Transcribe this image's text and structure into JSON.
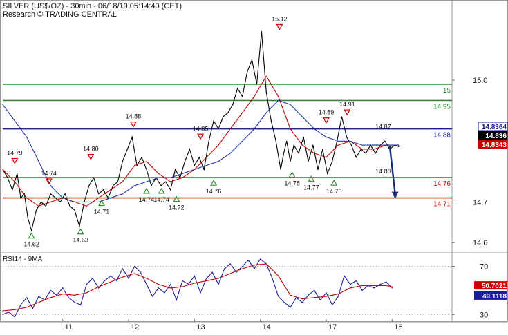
{
  "header": {
    "title": "SILVER (US$/OZ) - 30min - 06/18/19 05:14:40 (CET)",
    "subtitle": "Research © TRADING CENTRAL"
  },
  "colors": {
    "price": "#000000",
    "ma_fast": "#c00000",
    "ma_slow": "#2233aa",
    "resistance": "#2e8b2e",
    "pivot": "#1a1a9a",
    "support": "#cc0000",
    "marker_up": "#2e8b2e",
    "marker_down": "#cc0000",
    "forecast_arrow": "#1a2a7a",
    "last_price_tag": "#000000"
  },
  "chart_data": [
    {
      "type": "line",
      "name": "price",
      "yscale": "linear",
      "ylim": [
        14.58,
        15.16
      ],
      "x_ticks": [
        "11",
        "12",
        "13",
        "14",
        "17",
        "18"
      ],
      "x_tick_pos": [
        1.3,
        2.4,
        3.5,
        4.6,
        5.7,
        6.8
      ],
      "xlim": [
        0.3,
        7.8
      ],
      "y_ticks": [
        14.6,
        14.7,
        15.0
      ],
      "grid": false,
      "series": [
        {
          "role": "price",
          "x": [
            0.3,
            0.38,
            0.46,
            0.54,
            0.6,
            0.66,
            0.72,
            0.78,
            0.86,
            0.94,
            1.02,
            1.1,
            1.18,
            1.26,
            1.34,
            1.42,
            1.5,
            1.58,
            1.66,
            1.74,
            1.82,
            1.9,
            1.98,
            2.06,
            2.14,
            2.22,
            2.3,
            2.38,
            2.46,
            2.54,
            2.62,
            2.7,
            2.78,
            2.86,
            2.94,
            3.02,
            3.1,
            3.18,
            3.26,
            3.34,
            3.42,
            3.5,
            3.58,
            3.66,
            3.74,
            3.82,
            3.9,
            3.98,
            4.06,
            4.14,
            4.22,
            4.3,
            4.38,
            4.46,
            4.54,
            4.62,
            4.7,
            4.78,
            4.86,
            4.94,
            4.99,
            5.04,
            5.1,
            5.16,
            5.24,
            5.32,
            5.4,
            5.48,
            5.56,
            5.64,
            5.72,
            5.8,
            5.88,
            5.96,
            6.04,
            6.12,
            6.2,
            6.28,
            6.36,
            6.44,
            6.52,
            6.6,
            6.68,
            6.76,
            6.84,
            6.92
          ],
          "values": [
            14.78,
            14.76,
            14.73,
            14.77,
            14.71,
            14.72,
            14.66,
            14.63,
            14.68,
            14.7,
            14.69,
            14.72,
            14.71,
            14.7,
            14.72,
            14.69,
            14.68,
            14.64,
            14.7,
            14.74,
            14.76,
            14.72,
            14.73,
            14.71,
            14.74,
            14.75,
            14.8,
            14.83,
            14.86,
            14.79,
            14.81,
            14.78,
            14.74,
            14.76,
            14.74,
            14.75,
            14.73,
            14.78,
            14.76,
            14.8,
            14.83,
            14.79,
            14.81,
            14.78,
            14.85,
            14.9,
            14.88,
            14.91,
            14.92,
            14.94,
            14.98,
            14.96,
            15.02,
            15.05,
            14.99,
            15.12,
            14.97,
            14.9,
            14.85,
            14.78,
            14.82,
            14.85,
            14.8,
            14.84,
            14.82,
            14.86,
            14.8,
            14.84,
            14.78,
            14.83,
            14.77,
            14.8,
            14.85,
            14.91,
            14.86,
            14.84,
            14.81,
            14.83,
            14.82,
            14.84,
            14.82,
            14.84,
            14.85,
            14.83,
            14.84,
            14.836
          ]
        },
        {
          "role": "ma_fast",
          "x": [
            0.3,
            0.5,
            0.7,
            0.9,
            1.1,
            1.3,
            1.5,
            1.7,
            1.9,
            2.1,
            2.3,
            2.5,
            2.7,
            2.9,
            3.1,
            3.3,
            3.5,
            3.7,
            3.9,
            4.1,
            4.3,
            4.5,
            4.7,
            4.9,
            5.1,
            5.3,
            5.5,
            5.7,
            5.9,
            6.1,
            6.3,
            6.5,
            6.7,
            6.92
          ],
          "values": [
            14.78,
            14.75,
            14.71,
            14.69,
            14.7,
            14.71,
            14.7,
            14.69,
            14.71,
            14.73,
            14.75,
            14.79,
            14.8,
            14.77,
            14.75,
            14.76,
            14.78,
            14.81,
            14.84,
            14.88,
            14.92,
            14.96,
            15.01,
            14.96,
            14.88,
            14.84,
            14.82,
            14.81,
            14.84,
            14.85,
            14.83,
            14.83,
            14.84,
            14.84
          ]
        },
        {
          "role": "ma_slow",
          "x": [
            0.3,
            0.5,
            0.7,
            0.9,
            1.1,
            1.3,
            1.5,
            1.7,
            1.9,
            2.1,
            2.3,
            2.5,
            2.7,
            2.9,
            3.1,
            3.3,
            3.5,
            3.7,
            3.9,
            4.1,
            4.3,
            4.5,
            4.7,
            4.9,
            5.1,
            5.3,
            5.5,
            5.7,
            5.9,
            6.1,
            6.3,
            6.5,
            6.7,
            6.92
          ],
          "values": [
            14.94,
            14.9,
            14.86,
            14.8,
            14.74,
            14.71,
            14.7,
            14.7,
            14.7,
            14.71,
            14.72,
            14.74,
            14.75,
            14.76,
            14.76,
            14.77,
            14.78,
            14.79,
            14.8,
            14.82,
            14.85,
            14.88,
            14.92,
            14.95,
            14.94,
            14.91,
            14.88,
            14.86,
            14.85,
            14.85,
            14.84,
            14.84,
            14.84,
            14.84
          ]
        }
      ],
      "levels": [
        {
          "value": 14.99,
          "label": "15",
          "role": "resistance"
        },
        {
          "value": 14.95,
          "label": "14.95",
          "role": "resistance"
        },
        {
          "value": 14.88,
          "label": "14.88",
          "role": "pivot"
        },
        {
          "value": 14.76,
          "label": "14.76",
          "role": "support"
        },
        {
          "value": 14.71,
          "label": "14.71",
          "role": "support"
        }
      ],
      "price_tags": [
        {
          "value": 14.8364,
          "label": "14.8364",
          "role": "pivot"
        },
        {
          "value": 14.836,
          "label": "14.836",
          "role": "last_price_tag"
        },
        {
          "value": 14.8343,
          "label": "14.8343",
          "role": "support"
        }
      ],
      "annotations": [
        {
          "x": 0.78,
          "value": 14.63,
          "label": "14.62",
          "dir": "up"
        },
        {
          "x": 0.5,
          "value": 14.79,
          "label": "14.79",
          "dir": "down"
        },
        {
          "x": 1.07,
          "value": 14.74,
          "label": "14.74",
          "dir": "down"
        },
        {
          "x": 1.6,
          "value": 14.64,
          "label": "14.63",
          "dir": "up"
        },
        {
          "x": 1.77,
          "value": 14.8,
          "label": "14.80",
          "dir": "down"
        },
        {
          "x": 1.95,
          "value": 14.71,
          "label": "14.71",
          "dir": "up"
        },
        {
          "x": 2.48,
          "value": 14.88,
          "label": "14.88",
          "dir": "down"
        },
        {
          "x": 2.7,
          "value": 14.74,
          "label": "14.74",
          "dir": "up"
        },
        {
          "x": 2.95,
          "value": 14.74,
          "label": "14.74",
          "dir": "up"
        },
        {
          "x": 3.2,
          "value": 14.72,
          "label": "14.72",
          "dir": "up"
        },
        {
          "x": 3.6,
          "value": 14.85,
          "label": "14.85",
          "dir": "down"
        },
        {
          "x": 3.82,
          "value": 14.76,
          "label": "14.76",
          "dir": "up"
        },
        {
          "x": 4.92,
          "value": 15.12,
          "label": "15.12",
          "dir": "down"
        },
        {
          "x": 5.13,
          "value": 14.78,
          "label": "14.78",
          "dir": "up"
        },
        {
          "x": 5.45,
          "value": 14.77,
          "label": "14.77",
          "dir": "up"
        },
        {
          "x": 5.7,
          "value": 14.89,
          "label": "14.89",
          "dir": "down"
        },
        {
          "x": 5.83,
          "value": 14.76,
          "label": "14.76",
          "dir": "up"
        },
        {
          "x": 6.05,
          "value": 14.91,
          "label": "14.91",
          "dir": "down"
        },
        {
          "x": 6.65,
          "value": 14.87,
          "label": "14.87",
          "dir": "none"
        },
        {
          "x": 6.65,
          "value": 14.76,
          "label": "14.80",
          "dir": "none"
        }
      ],
      "forecast_arrow": {
        "x": [
          6.76,
          6.85
        ],
        "values": [
          14.838,
          14.71
        ]
      }
    },
    {
      "type": "line",
      "name": "RSI14 - 9MA",
      "title": "RSI14 - 9MA",
      "ylim": [
        25,
        80
      ],
      "y_ticks": [
        30,
        70
      ],
      "xlim": [
        0.3,
        7.8
      ],
      "series": [
        {
          "role": "rsi",
          "x": [
            0.3,
            0.4,
            0.5,
            0.6,
            0.7,
            0.8,
            0.9,
            1.0,
            1.1,
            1.2,
            1.3,
            1.4,
            1.5,
            1.6,
            1.7,
            1.8,
            1.9,
            2.0,
            2.1,
            2.2,
            2.3,
            2.4,
            2.5,
            2.6,
            2.7,
            2.8,
            2.9,
            3.0,
            3.1,
            3.2,
            3.3,
            3.4,
            3.5,
            3.6,
            3.7,
            3.8,
            3.9,
            4.0,
            4.1,
            4.2,
            4.3,
            4.4,
            4.5,
            4.6,
            4.7,
            4.8,
            4.9,
            5.0,
            5.1,
            5.2,
            5.3,
            5.4,
            5.5,
            5.6,
            5.7,
            5.8,
            5.9,
            6.0,
            6.1,
            6.2,
            6.3,
            6.4,
            6.5,
            6.6,
            6.7,
            6.8
          ],
          "values": [
            30,
            32,
            28,
            38,
            44,
            35,
            45,
            42,
            50,
            46,
            52,
            44,
            40,
            38,
            55,
            60,
            52,
            58,
            62,
            58,
            68,
            60,
            70,
            65,
            55,
            45,
            52,
            48,
            55,
            42,
            58,
            55,
            62,
            48,
            60,
            65,
            55,
            68,
            72,
            65,
            70,
            75,
            68,
            76,
            72,
            60,
            45,
            40,
            36,
            44,
            40,
            46,
            50,
            42,
            48,
            38,
            45,
            62,
            55,
            58,
            50,
            54,
            52,
            55,
            57,
            52
          ]
        },
        {
          "role": "rsi_ma",
          "x": [
            0.3,
            0.5,
            0.7,
            0.9,
            1.1,
            1.3,
            1.5,
            1.7,
            1.9,
            2.1,
            2.3,
            2.5,
            2.7,
            2.9,
            3.1,
            3.3,
            3.5,
            3.7,
            3.9,
            4.1,
            4.3,
            4.5,
            4.7,
            4.9,
            5.1,
            5.3,
            5.5,
            5.7,
            5.9,
            6.1,
            6.3,
            6.5,
            6.7,
            6.8
          ],
          "values": [
            33,
            34,
            36,
            40,
            44,
            47,
            46,
            48,
            53,
            57,
            61,
            64,
            60,
            55,
            52,
            53,
            56,
            58,
            60,
            64,
            68,
            71,
            72,
            62,
            46,
            43,
            44,
            45,
            47,
            52,
            54,
            54,
            54,
            53
          ]
        }
      ],
      "price_tags": [
        {
          "value": 50.7021,
          "label": "50.7021",
          "role": "support"
        },
        {
          "value": 49.1118,
          "label": "49.1118",
          "role": "pivot"
        }
      ]
    }
  ]
}
